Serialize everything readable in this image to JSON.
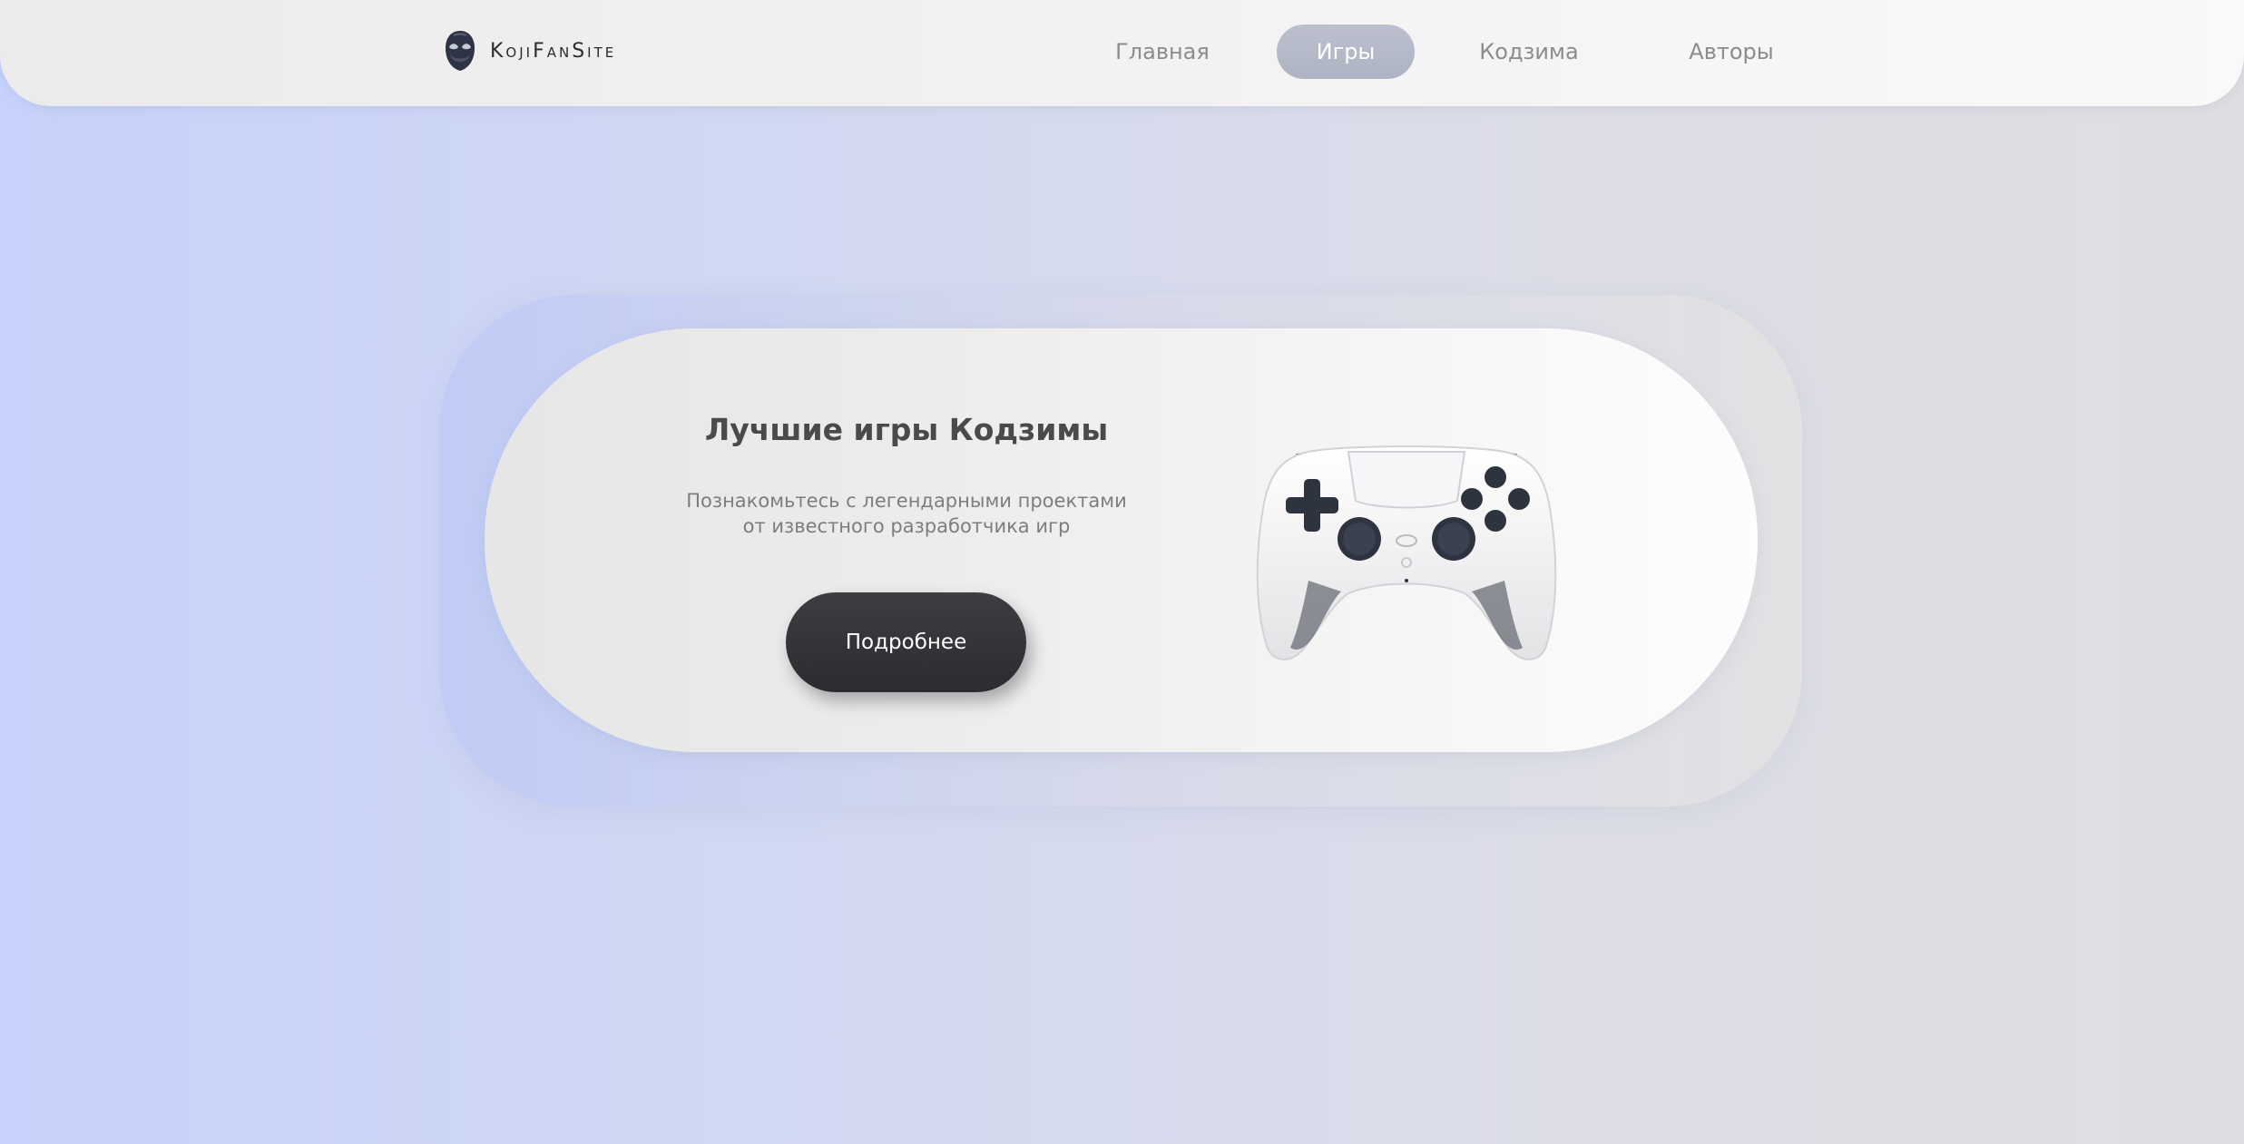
{
  "header": {
    "logo_text": "KojiFanSite",
    "logo_icon": "mask-icon",
    "nav": [
      {
        "label": "Главная",
        "active": false
      },
      {
        "label": "Игры",
        "active": true
      },
      {
        "label": "Кодзима",
        "active": false
      },
      {
        "label": "Авторы",
        "active": false
      }
    ]
  },
  "hero": {
    "title": "Лучшие игры Кодзимы",
    "description": "Познакомьтесь с легендарными проектами\nот известного разработчика игр",
    "button_label": "Подробнее",
    "image_icon": "gamepad-icon"
  },
  "colors": {
    "background_start": "#c6d2fb",
    "background_end": "#dedee2",
    "nav_active_bg": "#b4b8c8",
    "button_bg": "#333337",
    "title_text": "#4a4a4c"
  }
}
